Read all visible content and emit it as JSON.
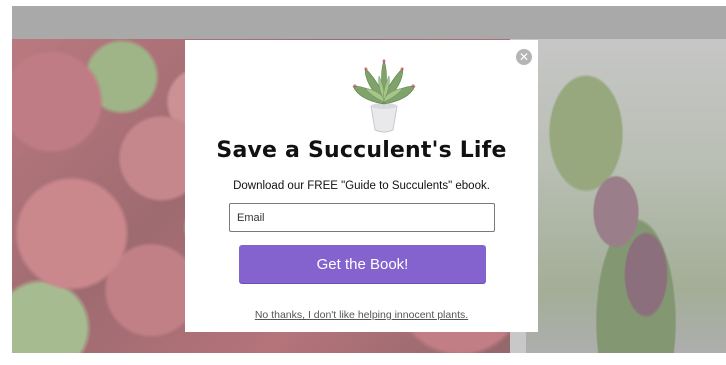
{
  "popup": {
    "title": "Save a Succulent's Life",
    "subtitle": "Download our FREE \"Guide to Succulents\" ebook.",
    "email_placeholder": "Email",
    "email_value": "",
    "cta_label": "Get the Book!",
    "decline_link": "No thanks, I don't like helping innocent plants.",
    "close_icon": "close-icon",
    "image_icon": "potted-succulent-icon"
  },
  "colors": {
    "cta_background": "#8563cf",
    "overlay": "#a9a9a9",
    "close_button": "#b5b5b5"
  }
}
